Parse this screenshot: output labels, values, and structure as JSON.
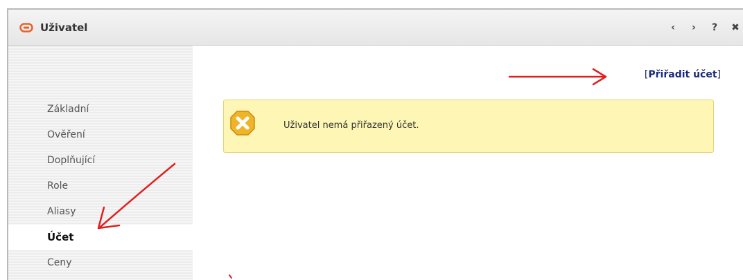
{
  "window": {
    "title": "Uživatel",
    "icon": "link-icon",
    "controls": {
      "prev": "‹",
      "next": "›",
      "help": "?",
      "settings": "✖"
    }
  },
  "sidebar": {
    "items": [
      {
        "label": "Základní",
        "active": false
      },
      {
        "label": "Ověření",
        "active": false
      },
      {
        "label": "Doplňující",
        "active": false
      },
      {
        "label": "Role",
        "active": false
      },
      {
        "label": "Aliasy",
        "active": false
      },
      {
        "label": "Účet",
        "active": true
      },
      {
        "label": "Ceny",
        "active": false
      }
    ]
  },
  "main": {
    "assign_link": {
      "bracket_open": "[",
      "label": "Přiřadit účet",
      "bracket_close": "]"
    },
    "alert": {
      "icon": "warning-x-icon",
      "message": "Uživatel nemá přiřazený účet."
    }
  },
  "colors": {
    "alert_bg": "#fdf6b4",
    "alert_border": "#e3d47a",
    "alert_icon": "#f0b429",
    "annotation_arrow": "#e02020",
    "link": "#1b2a7a",
    "title_icon": "#e8622a"
  }
}
